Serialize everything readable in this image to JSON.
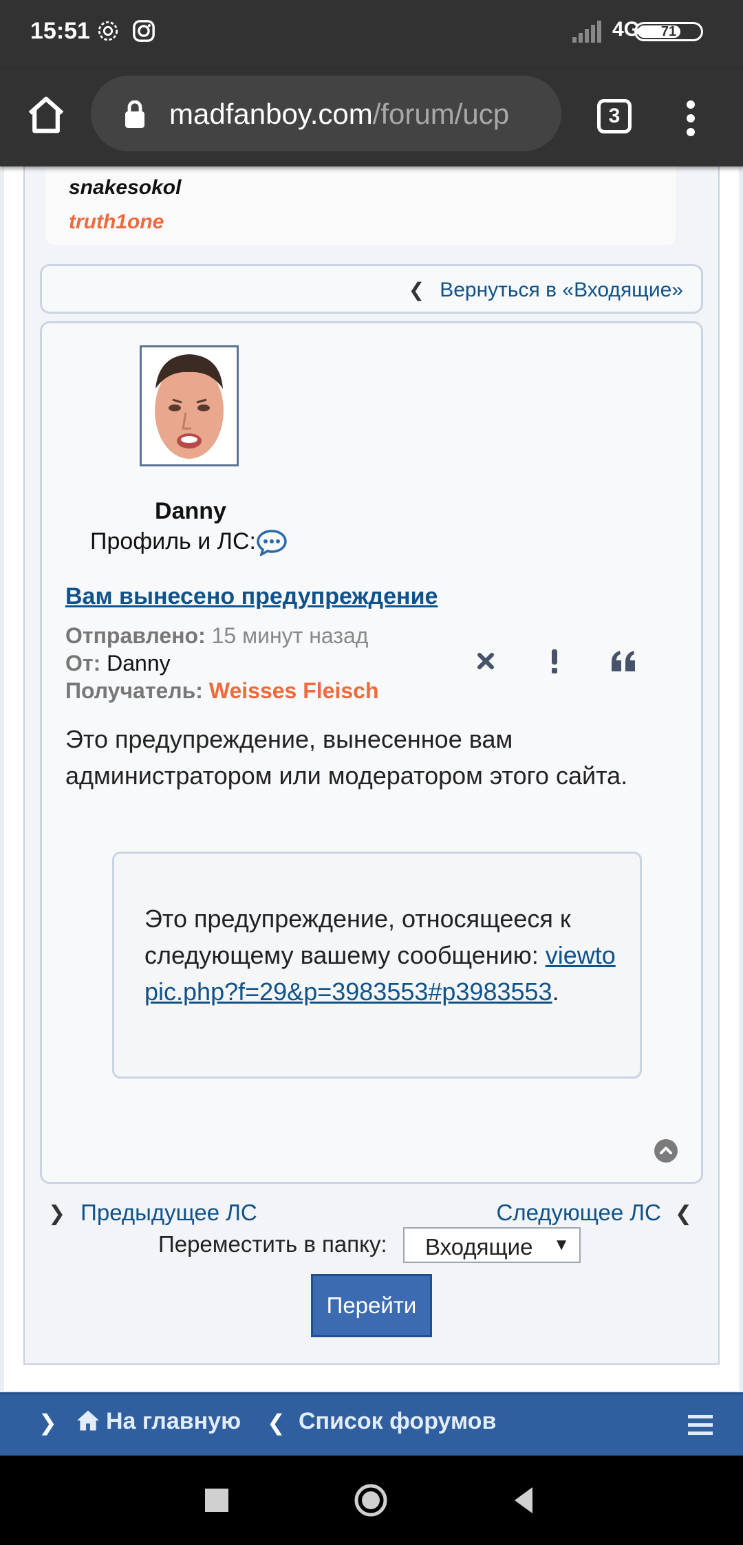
{
  "status_bar": {
    "time": "15:51",
    "network": "4G",
    "battery": "71"
  },
  "browser": {
    "url_host": "madfanboy.com",
    "url_path": "/forum/ucp",
    "tab_count": "3"
  },
  "users_list": {
    "user1": "snakesokol",
    "user2": "truth1one"
  },
  "back_link": "Вернуться в «Входящие»",
  "message": {
    "author": "Danny",
    "profile_label": "Профиль и ЛС:",
    "title": "Вам вынесено предупреждение",
    "sent_label": "Отправлено:",
    "sent_value": " 15 минут назад",
    "from_label": "От:",
    "from_value": " Danny",
    "recipient_label": "Получатель:",
    "recipient_value": " Weisses Fleisch",
    "body": "Это предупреждение, вынесенное вам администратором или модератором этого сайта.",
    "notice_text": "Это предупреждение, относящееся к следующему вашему сообщению: ",
    "notice_link": "viewtopic.php?f=29&p=3983553#p3983553",
    "notice_end": "."
  },
  "pagination": {
    "prev": "Предыдущее ЛС",
    "next": "Следующее ЛС"
  },
  "move": {
    "label": "Переместить в папку:",
    "selected": "Входящие",
    "button": "Перейти"
  },
  "bottom_nav": {
    "home": "На главную",
    "forums": "Список форумов"
  },
  "colors": {
    "link": "#105289",
    "accent_orange": "#ee6a3c",
    "nav_blue": "#2f5f9e"
  },
  "icons": [
    "settings-icon",
    "instagram-icon",
    "home-icon",
    "lock-icon",
    "pm-icon",
    "delete-icon",
    "report-icon",
    "quote-icon",
    "back-to-top-icon",
    "menu-icon"
  ]
}
